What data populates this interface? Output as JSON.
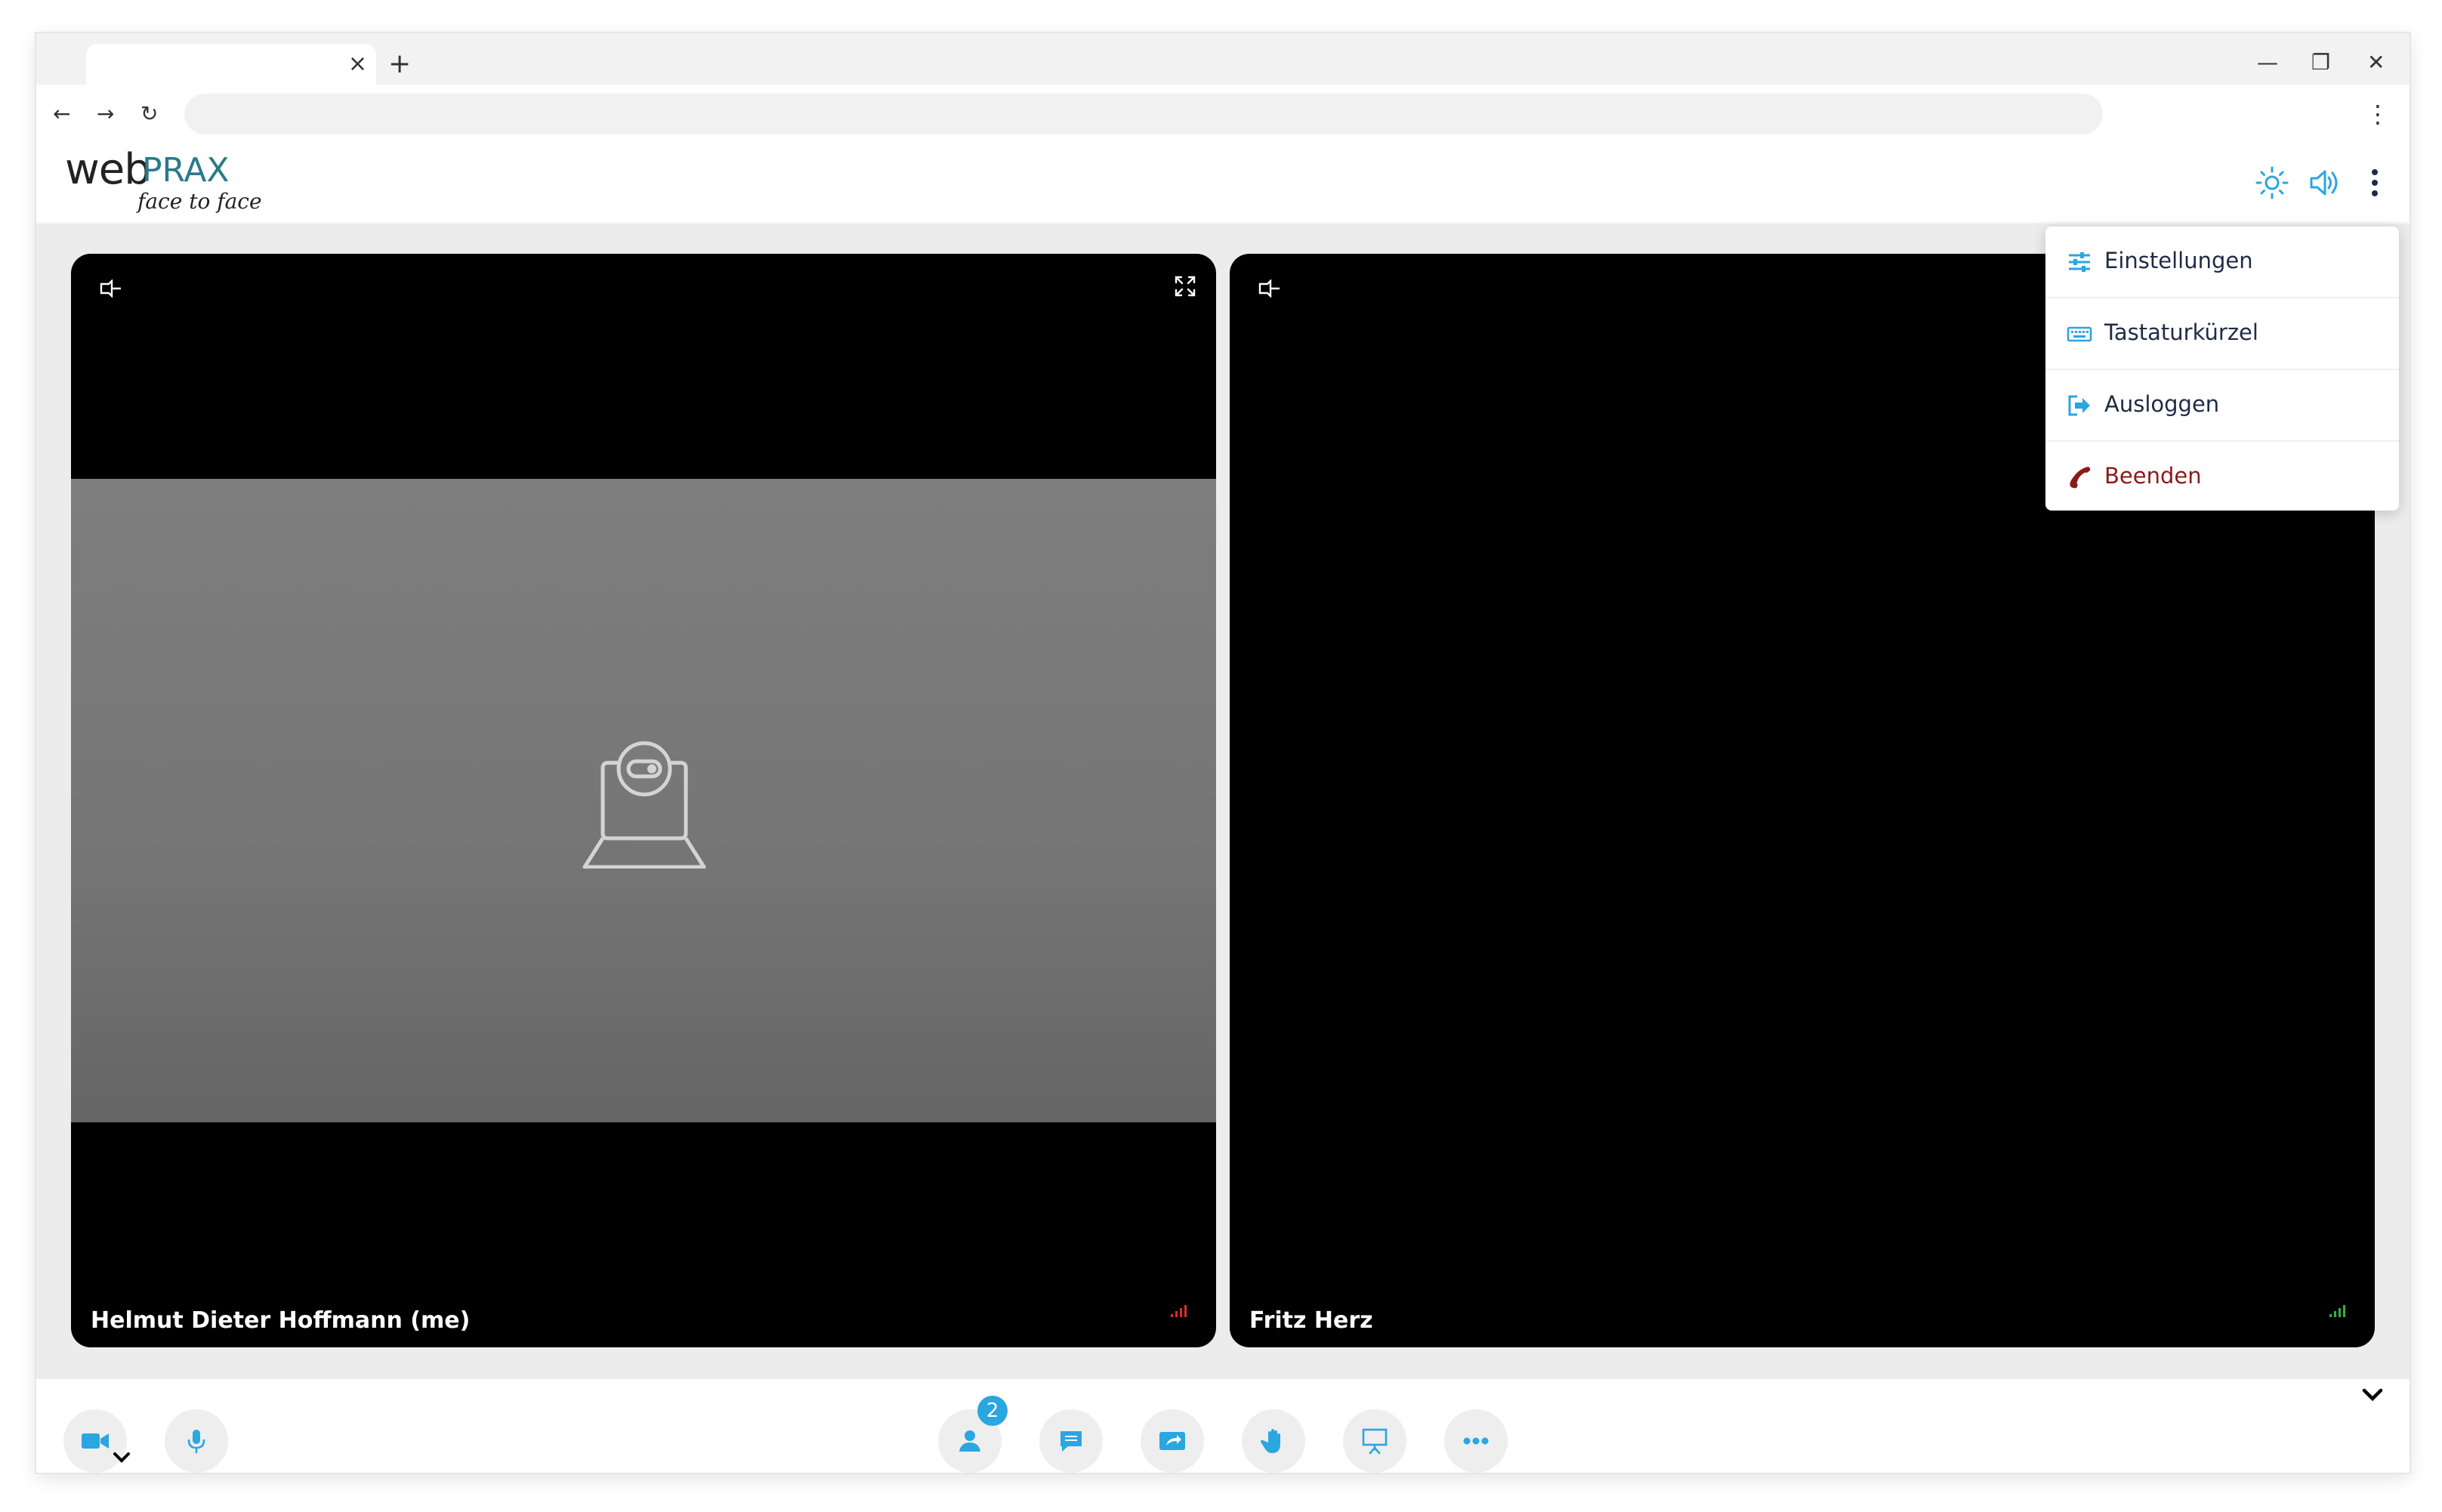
{
  "browser": {
    "tab_close": "×",
    "new_tab": "+",
    "window_controls": {
      "minimize": "—",
      "restore": "❐",
      "close": "✕"
    },
    "nav": {
      "back": "←",
      "forward": "→",
      "reload": "↻"
    },
    "menu": "⋮"
  },
  "app": {
    "logo": {
      "word": "web",
      "brand": "PRAX",
      "tagline": "face to face"
    },
    "header_icons": [
      "brightness-icon",
      "volume-icon",
      "more-vertical-icon"
    ],
    "accent_color": "#2aa6e0"
  },
  "participants": [
    {
      "name": "Helmut Dieter Hoffmann (me)",
      "video": "camera-off-placeholder",
      "signal_color": "#d93025"
    },
    {
      "name": "Fritz Herz",
      "video": "black",
      "signal_color": "#2fb344"
    }
  ],
  "menu": {
    "items": [
      {
        "label": "Einstellungen",
        "icon": "sliders-icon"
      },
      {
        "label": "Tastaturkürzel",
        "icon": "keyboard-icon"
      },
      {
        "label": "Ausloggen",
        "icon": "logout-icon"
      },
      {
        "label": "Beenden",
        "icon": "hangup-icon",
        "color": "#8b1a1a"
      }
    ]
  },
  "toolbar": {
    "left": [
      "camera-icon",
      "microphone-icon"
    ],
    "center": [
      "participants-icon",
      "chat-icon",
      "share-screen-icon",
      "raise-hand-icon",
      "whiteboard-icon",
      "more-horizontal-icon"
    ],
    "participants_badge": "2"
  }
}
